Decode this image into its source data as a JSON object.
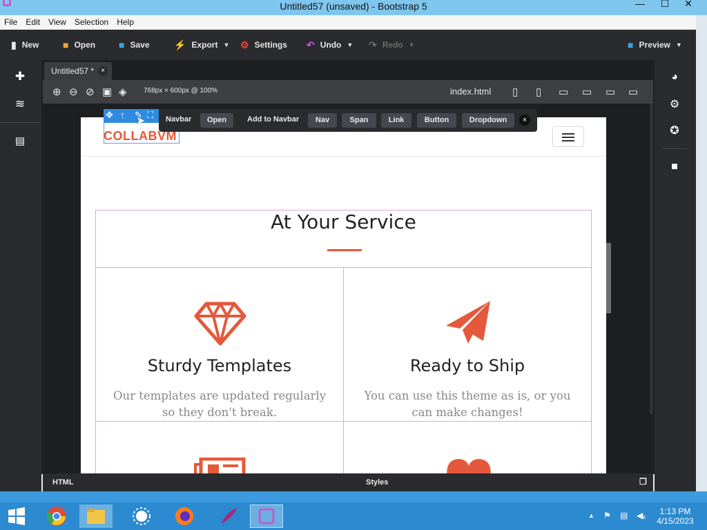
{
  "window": {
    "title": "Untitled57 (unsaved) - Bootstrap 5",
    "minimize": "—",
    "maximize": "☐",
    "close": "✕"
  },
  "menu": [
    "File",
    "Edit",
    "View",
    "Selection",
    "Help"
  ],
  "toolbar": {
    "new": "New",
    "open": "Open",
    "save": "Save",
    "export": "Export",
    "settings": "Settings",
    "undo": "Undo",
    "redo": "Redo",
    "preview": "Preview"
  },
  "tab": {
    "label": "Untitled57 *"
  },
  "canvas_bar": {
    "size_label": "768px × 600px @ 100%",
    "file": "index.html"
  },
  "context_bar": {
    "label": "Navbar",
    "open": "Open",
    "add_label": "Add to Navbar",
    "buttons": [
      "Nav",
      "Span",
      "Link",
      "Button",
      "Dropdown"
    ]
  },
  "page": {
    "brand": "COLLABVM",
    "section_title": "At Your Service",
    "cards": [
      {
        "title": "Sturdy Templates",
        "text": "Our templates are updated regularly so they don't break."
      },
      {
        "title": "Ready to Ship",
        "text": "You can use this theme as is, or you can make changes!"
      }
    ]
  },
  "bottom": {
    "html": "HTML",
    "styles": "Styles"
  },
  "taskbar": {
    "time": "1:13 PM",
    "date": "4/15/2023"
  },
  "colors": {
    "accent": "#e4593b",
    "selection": "#2e8be0",
    "outline": "#e6a1dc"
  }
}
